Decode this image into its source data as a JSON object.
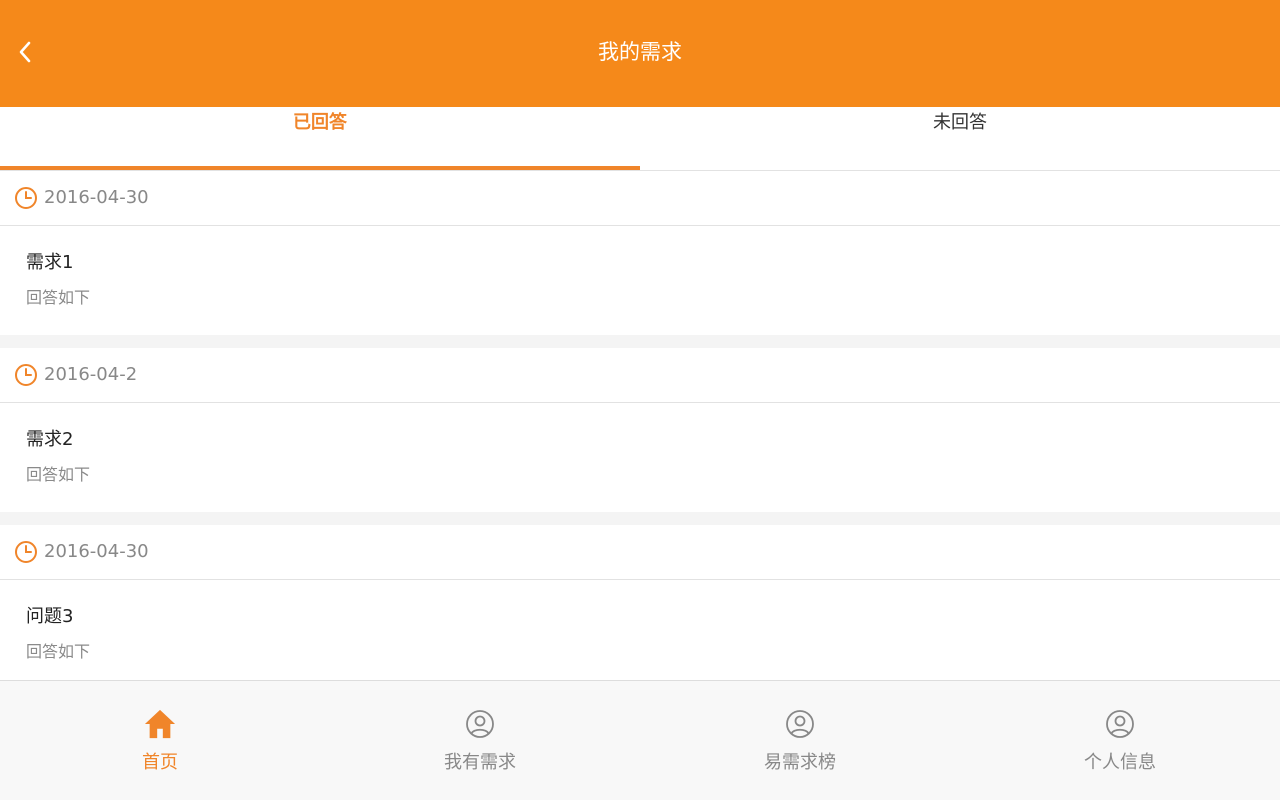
{
  "header": {
    "title": "我的需求",
    "back_icon": "chevron-left-icon"
  },
  "tabs": [
    {
      "label": "已回答",
      "active": true
    },
    {
      "label": "未回答",
      "active": false
    }
  ],
  "items": [
    {
      "date": "2016-04-30",
      "title": "需求1",
      "subtitle": "回答如下"
    },
    {
      "date": "2016-04-2",
      "title": "需求2",
      "subtitle": "回答如下"
    },
    {
      "date": "2016-04-30",
      "title": "问题3",
      "subtitle": "回答如下"
    }
  ],
  "bottom_nav": [
    {
      "label": "首页",
      "icon": "home-icon",
      "active": true
    },
    {
      "label": "我有需求",
      "icon": "user-circle-icon",
      "active": false
    },
    {
      "label": "易需求榜",
      "icon": "user-circle-icon",
      "active": false
    },
    {
      "label": "个人信息",
      "icon": "user-circle-icon",
      "active": false
    }
  ],
  "colors": {
    "accent": "#f5891a",
    "active_text": "#f0852a",
    "muted_text": "#888888",
    "divider": "#e2e2e2"
  }
}
